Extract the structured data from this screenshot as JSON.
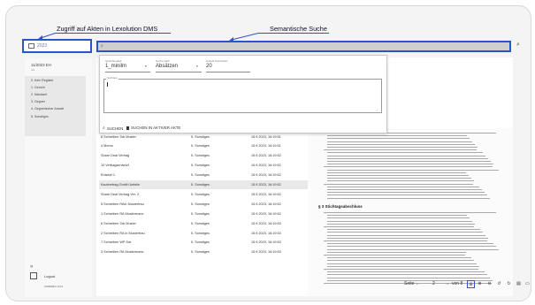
{
  "annotations": {
    "left": "Zugriff auf Akten in Lexolution DMS",
    "right": "Semantische Suche"
  },
  "file_search": {
    "value": "2023"
  },
  "sidebar": {
    "file_title": "11/2023 EH",
    "file_sub": "n/a",
    "menu": [
      "0. Kein Register",
      "1. Gericht",
      "2. Mandant",
      "3. Gegner",
      "4. Gegnerischer Anwalt",
      "5. Sonstiges"
    ],
    "collapse_icon": "double-chevron-left",
    "logout": "Logout",
    "footer": "HOMEDEV\\ 14:16"
  },
  "search_panel": {
    "sprachmodell_label": "Sprachmodell",
    "sprachmodell_value": "1_minilm",
    "suche_nach_label": "Suche nach",
    "suche_nach_value": "Absätzen",
    "anzahl_label": "Anzahl Suchtreffer",
    "anzahl_value": "20",
    "suchtext_label": "Suchtext",
    "btn_suchen": "SUCHEN",
    "btn_aktive": "SUCHEN IN AKTIVER AKTE"
  },
  "documents": [
    {
      "name": "8 Schreiben Sdr Muster",
      "reg": "5. Sonstiges",
      "date": "15.9.2023, 16:19:51"
    },
    {
      "name": "4 Memo",
      "reg": "5. Sonstiges",
      "date": "15.9.2023, 16:19:51"
    },
    {
      "name": "Share Deal Vertrag",
      "reg": "5. Sonstiges",
      "date": "15.9.2023, 16:19:52"
    },
    {
      "name": "10 Vertragsentwurf",
      "reg": "5. Sonstiges",
      "date": "15.9.2023, 16:19:52"
    },
    {
      "name": "Entwurf 1",
      "reg": "5. Sonstiges",
      "date": "15.9.2023, 16:19:52"
    },
    {
      "name": "Kaufvertrag GmbH Anteile",
      "reg": "5. Sonstiges",
      "date": "15.9.2023, 16:19:52"
    },
    {
      "name": "Share Deal Vertrag Ver. 2",
      "reg": "5. Sonstiges",
      "date": "15.9.2023, 16:19:52"
    },
    {
      "name": "5 Schreiben RAin Musterfrau",
      "reg": "5. Sonstiges",
      "date": "15.9.2023, 16:19:52"
    },
    {
      "name": "1 Schreiben RA Mustermann",
      "reg": "5. Sonstiges",
      "date": "15.9.2023, 16:19:52"
    },
    {
      "name": "6 Schreiben Sdr Muster",
      "reg": "5. Sonstiges",
      "date": "15.9.2023, 16:19:53"
    },
    {
      "name": "2 Schreiben RA in Musterfrau",
      "reg": "5. Sonstiges",
      "date": "15.9.2023, 16:19:53"
    },
    {
      "name": "7 Schreiben WP Sdr",
      "reg": "5. Sonstiges",
      "date": "15.9.2023, 16:19:53"
    },
    {
      "name": "3 Schreiben RA Mustermann",
      "reg": "5. Sonstiges",
      "date": "15.9.2023, 16:19:53"
    }
  ],
  "viewer": {
    "section_heading": "§ 3 Stichtagsabschluss",
    "pager_label": "Seite",
    "current_page": "2",
    "page_total": "von 8"
  }
}
